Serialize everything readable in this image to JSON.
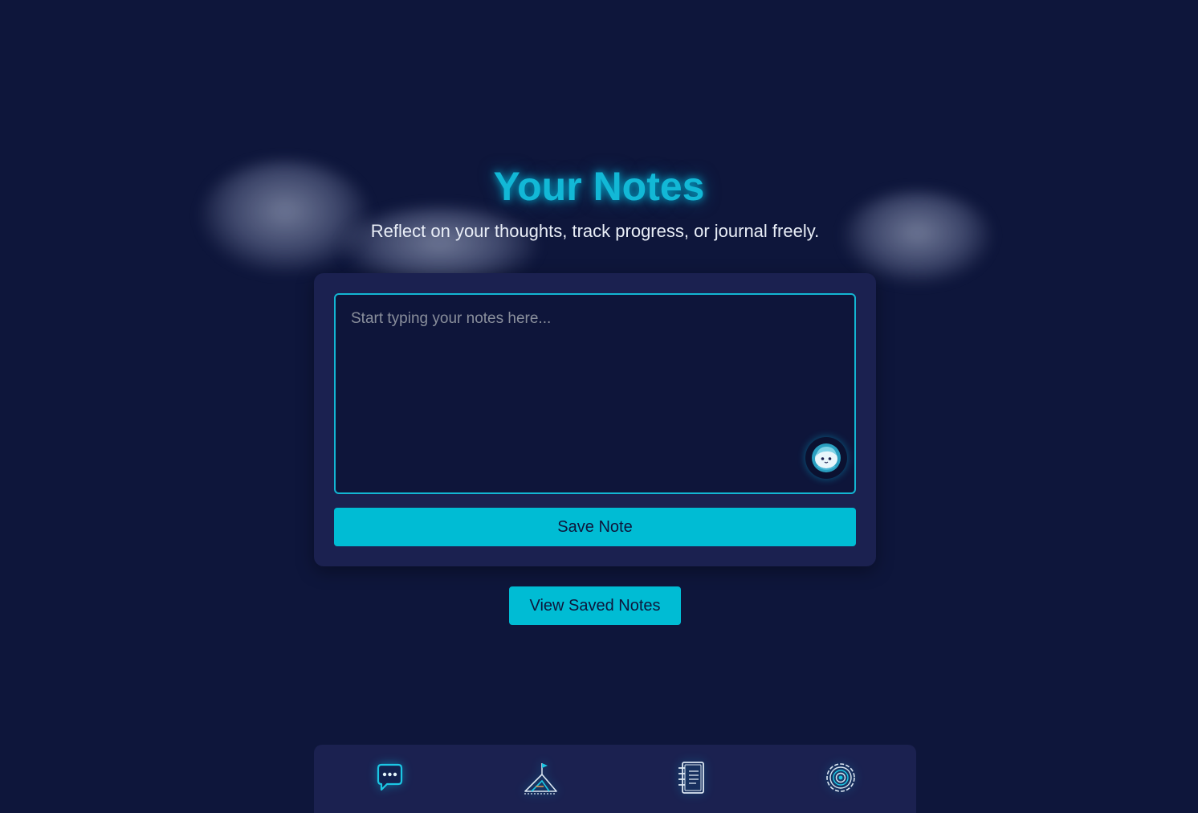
{
  "page": {
    "title": "Your Notes",
    "subtitle": "Reflect on your thoughts, track progress, or journal freely."
  },
  "editor": {
    "placeholder": "Start typing your notes here...",
    "value": "",
    "assistant_icon": "assistant-mascot-icon"
  },
  "actions": {
    "save_label": "Save Note",
    "view_saved_label": "View Saved Notes"
  },
  "bottom_nav": {
    "items": [
      {
        "icon": "chat-bubble-icon"
      },
      {
        "icon": "mountain-flag-icon"
      },
      {
        "icon": "notebook-icon"
      },
      {
        "icon": "gear-icon"
      }
    ]
  },
  "colors": {
    "background": "#0e163b",
    "card": "#1b2150",
    "accent": "#00bcd4"
  }
}
